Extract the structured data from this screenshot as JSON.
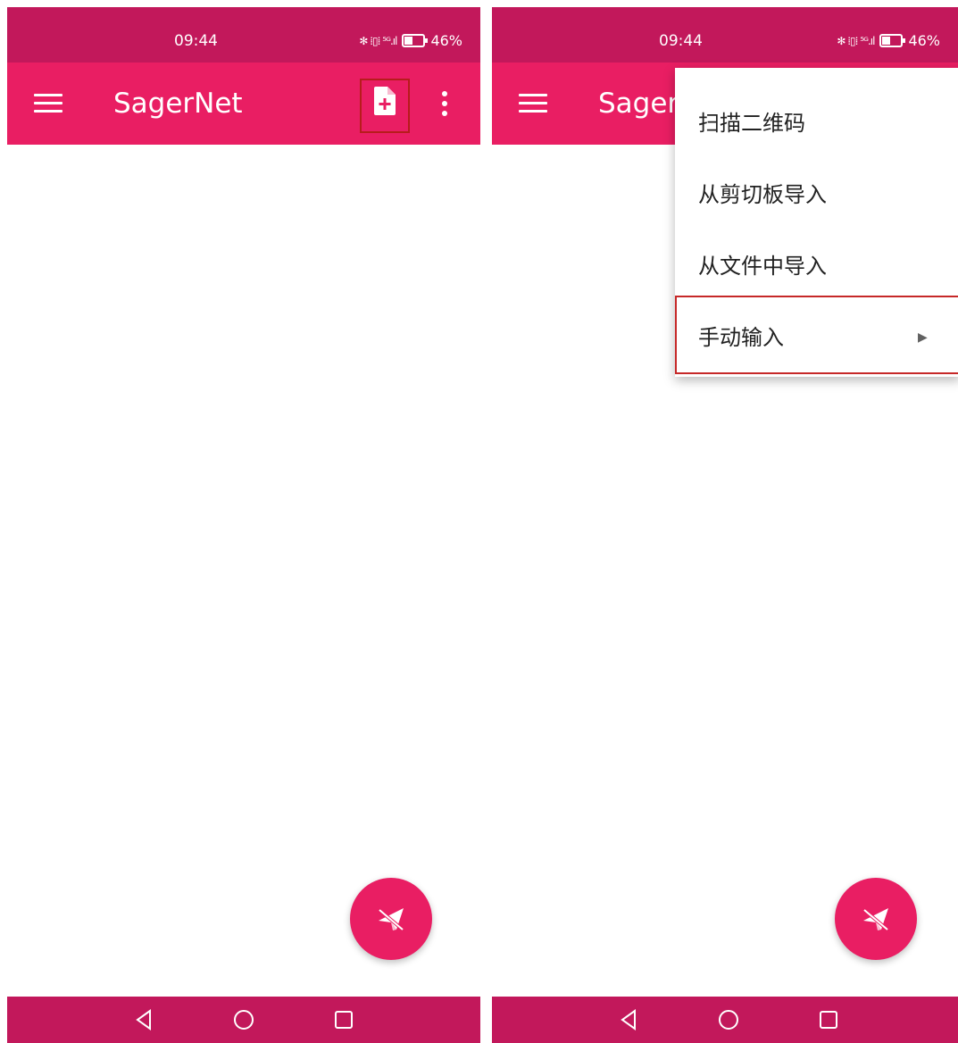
{
  "colors": {
    "status_bar": "#c2185b",
    "app_bar": "#e91e63",
    "fab": "#e91e63",
    "highlight": "#c62828"
  },
  "status": {
    "time": "09:44",
    "indicators": "✻ ⁞▯⁞ ⁵ᴳ.ıl",
    "battery": "46%"
  },
  "app": {
    "title": "SagerNet",
    "title_truncated": "Sager",
    "menu_icon": "hamburger-icon",
    "add_icon": "add-file-icon",
    "overflow_icon": "more-vert-icon"
  },
  "menu": {
    "items": [
      {
        "label": "扫描二维码"
      },
      {
        "label": "从剪切板导入"
      },
      {
        "label": "从文件中导入"
      },
      {
        "label": "手动输入",
        "submenu_arrow": "▶"
      }
    ]
  },
  "nav": {
    "icons": [
      "back-icon",
      "home-icon",
      "recents-icon"
    ]
  },
  "fab": {
    "icon": "paper-plane-off-icon"
  }
}
